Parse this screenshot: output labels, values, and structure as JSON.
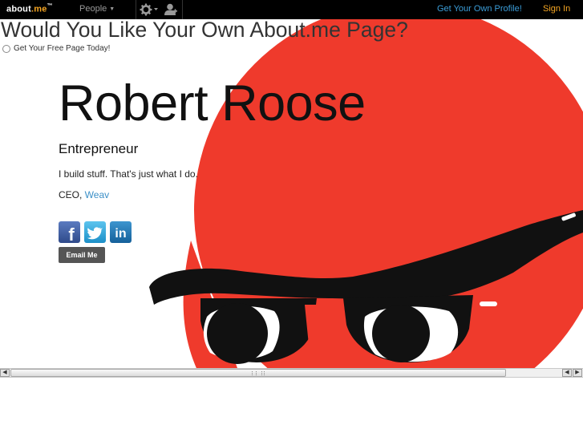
{
  "topbar": {
    "logo_main": "about",
    "logo_dotme": ".me",
    "logo_tm": "™",
    "people_label": "People",
    "people_caret": "▼",
    "get_profile_label": "Get Your Own Profile!",
    "sign_in_label": "Sign In",
    "icons": [
      "gear-icon",
      "chevron-down-icon",
      "user-icon"
    ]
  },
  "promo": {
    "title": "Would You Like Your Own About.me Page?",
    "radio_label": "Get Your Free Page Today!"
  },
  "profile": {
    "name": "Robert Roose",
    "headline": "Entrepreneur",
    "bio": "I build stuff. That's just what I do.",
    "job_prefix": "CEO, ",
    "company": "Weav",
    "email_button": "Email Me"
  },
  "social": {
    "facebook_glyph": "f",
    "linkedin_glyph": "in",
    "icons": [
      "facebook-icon",
      "twitter-icon",
      "linkedin-icon"
    ]
  },
  "scrollbar": {
    "left_arrow": "◀",
    "right_arrow": "▶"
  },
  "colors": {
    "accent_orange": "#f6a623",
    "link_blue": "#3b9dd8",
    "illustration_red": "#ef3a2c",
    "facebook_blue": "#3b5998",
    "twitter_blue": "#2ba7e0",
    "linkedin_blue": "#1c75b5"
  }
}
